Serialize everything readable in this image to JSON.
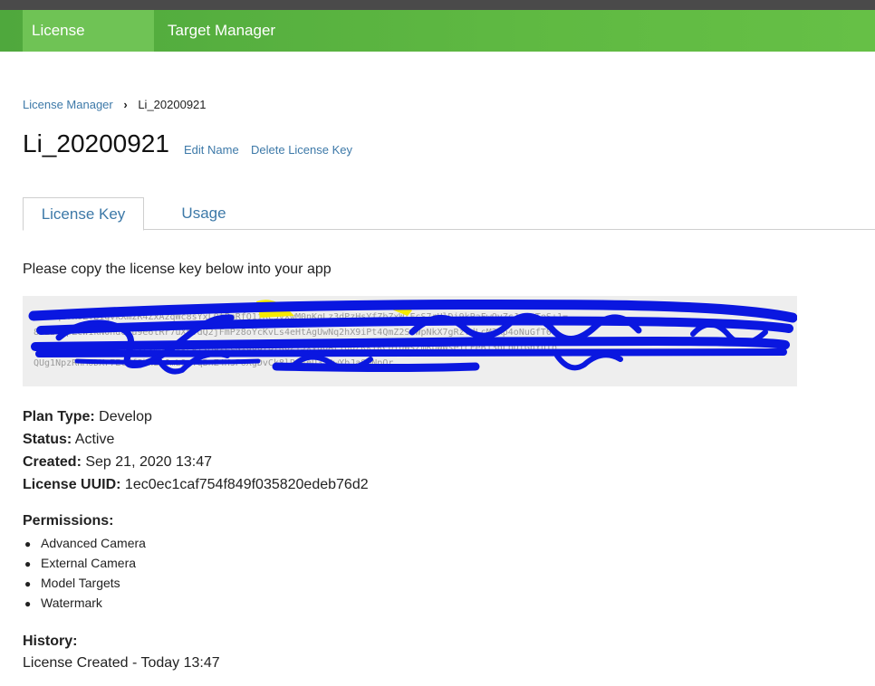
{
  "nav": {
    "items": [
      {
        "label": "License Manager",
        "active": true
      },
      {
        "label": "Target Manager",
        "active": false
      }
    ],
    "accent": "#5fb942"
  },
  "breadcrumb": {
    "parent": "License Manager",
    "separator": "›",
    "current": "Li_20200921"
  },
  "page": {
    "title": "Li_20200921",
    "edit_label": "Edit Name",
    "delete_label": "Delete License Key"
  },
  "tabs": [
    {
      "label": "License Key",
      "active": true
    },
    {
      "label": "Usage",
      "active": false
    }
  ],
  "instruction": "Please copy the license key below into your app",
  "license_key": {
    "redacted": true,
    "redaction_color": "#0a17e0",
    "highlight_color": "#f5ea00"
  },
  "details": {
    "plan_type": {
      "label": "Plan Type:",
      "value": "Develop"
    },
    "status": {
      "label": "Status:",
      "value": "Active"
    },
    "created": {
      "label": "Created:",
      "value": "Sep 21, 2020 13:47"
    },
    "uuid": {
      "label": "License UUID:",
      "value": "1ec0ec1caf754f849f035820edeb76d2"
    }
  },
  "permissions": {
    "label": "Permissions:",
    "items": [
      "Advanced Camera",
      "External Camera",
      "Model Targets",
      "Watermark"
    ]
  },
  "history": {
    "label": "History:",
    "entries": [
      "License Created - Today 13:47"
    ]
  },
  "colors": {
    "link": "#3d79a8",
    "nav_bg": "#5fb942",
    "nav_active": "#6fc355"
  }
}
